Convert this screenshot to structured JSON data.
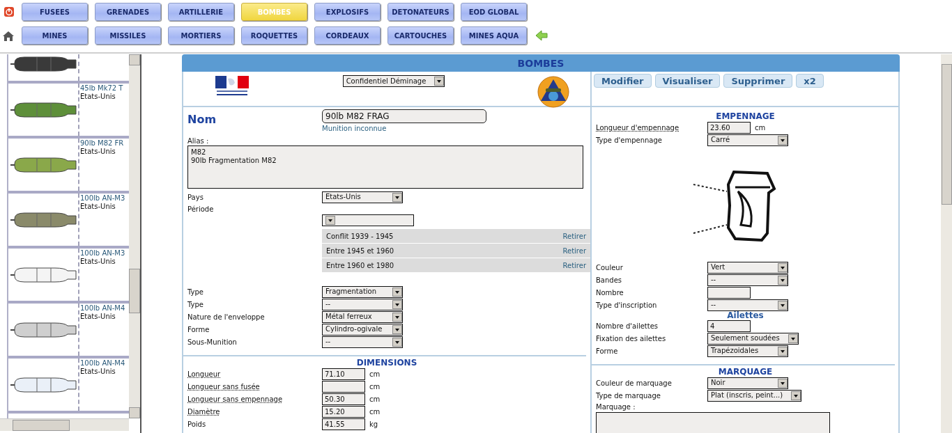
{
  "nav": {
    "rows": [
      [
        {
          "label": "FUSEES",
          "selected": false
        },
        {
          "label": "GRENADES",
          "selected": false
        },
        {
          "label": "ARTILLERIE",
          "selected": false
        },
        {
          "label": "BOMBES",
          "selected": true
        },
        {
          "label": "EXPLOSIFS",
          "selected": false
        },
        {
          "label": "DETONATEURS",
          "selected": false
        },
        {
          "label": "EOD GLOBAL",
          "selected": false
        }
      ],
      [
        {
          "label": "MINES",
          "selected": false
        },
        {
          "label": "MISSILES",
          "selected": false
        },
        {
          "label": "MORTIERS",
          "selected": false
        },
        {
          "label": "ROQUETTES",
          "selected": false
        },
        {
          "label": "CORDEAUX",
          "selected": false
        },
        {
          "label": "CARTOUCHES",
          "selected": false
        },
        {
          "label": "MINES AQUA",
          "selected": false
        }
      ]
    ]
  },
  "sidebar": {
    "items": [
      {
        "color": "#3a3a3a"
      },
      {
        "title": "45lb Mk72 T",
        "country": "Etats-Unis",
        "color": "#5e8f3a"
      },
      {
        "title": "90lb M82 FR",
        "country": "Etats-Unis",
        "color": "#8aa84a"
      },
      {
        "title": "100lb AN-M3",
        "country": "Etats-Unis",
        "color": "#8a8a6a"
      },
      {
        "title": "100lb AN-M3",
        "country": "Etats-Unis",
        "color": "#f4f4f4"
      },
      {
        "title": "100lb AN-M4",
        "country": "Etats-Unis",
        "color": "#cfcfcf"
      },
      {
        "title": "100lb AN-M4",
        "country": "Etats-Unis",
        "color": "#eaf0f8"
      }
    ]
  },
  "panel": {
    "title": "BOMBES",
    "classification": "Confidentiel Déminage",
    "actions": [
      "Modifier",
      "Visualiser",
      "Supprimer",
      "x2"
    ],
    "name": {
      "label": "Nom",
      "value": "90lb M82 FRAG",
      "status": "Munition inconnue"
    },
    "alias": {
      "label": "Alias :",
      "value": "M82\n90lb Fragmentation M82"
    },
    "country": {
      "label": "Pays",
      "value": "Etats-Unis"
    },
    "period": {
      "label": "Période",
      "entries": [
        {
          "label": "Conflit 1939 - 1945",
          "action": "Retirer"
        },
        {
          "label": "Entre 1945 et 1960",
          "action": "Retirer"
        },
        {
          "label": "Entre 1960 et 1980",
          "action": "Retirer"
        }
      ]
    },
    "fields": [
      {
        "kind": "select",
        "label": "Type",
        "value": "Fragmentation",
        "dotted": false
      },
      {
        "kind": "select",
        "label": "Type",
        "value": "--",
        "dotted": false
      },
      {
        "kind": "select",
        "label": "Nature de l'enveloppe",
        "value": "Métal ferreux",
        "dotted": false
      },
      {
        "kind": "select",
        "label": "Forme",
        "value": "Cylindro-ogivale",
        "dotted": false
      },
      {
        "kind": "select",
        "label": "Sous-Munition",
        "value": "--",
        "dotted": false
      }
    ],
    "dimensions": {
      "title": "DIMENSIONS",
      "fields": [
        {
          "kind": "input",
          "label": "Longueur",
          "value": "71.10",
          "unit": "cm",
          "dotted": true
        },
        {
          "kind": "input",
          "label": "Longueur sans fusée",
          "unit": "cm",
          "dotted": true
        },
        {
          "kind": "input",
          "label": "Longueur sans empennage",
          "value": "50.30",
          "unit": "cm",
          "dotted": true
        },
        {
          "kind": "input",
          "label": "Diamètre",
          "value": "15.20",
          "unit": "cm",
          "dotted": true
        },
        {
          "kind": "input",
          "label": "Poids",
          "value": "41.55",
          "unit": "kg",
          "dotted": false
        }
      ]
    },
    "empennage": {
      "title": "EMPENNAGE",
      "fields": [
        {
          "kind": "input",
          "label": "Longueur d'empennage",
          "value": "23.60",
          "unit": "cm",
          "dotted": true
        },
        {
          "kind": "select",
          "label": "Type d'empennage",
          "value": "Carré",
          "dotted": false
        }
      ],
      "fields_after": [
        {
          "kind": "select",
          "label": "Couleur",
          "value": "Vert",
          "dotted": false
        },
        {
          "kind": "select",
          "label": "Bandes",
          "value": "--",
          "dotted": false
        },
        {
          "kind": "input",
          "label": "Nombre",
          "dotted": false
        },
        {
          "kind": "select",
          "label": "Type d'inscription",
          "value": "--",
          "dotted": false
        }
      ]
    },
    "ailettes": {
      "title": "Ailettes",
      "fields": [
        {
          "kind": "input",
          "label": "Nombre d'ailettes",
          "value": "4",
          "dotted": false
        },
        {
          "kind": "select",
          "label": "Fixation des ailettes",
          "value": "Seulement soudées",
          "dotted": false
        },
        {
          "kind": "select",
          "label": "Forme",
          "value": "Trapézoidales",
          "dotted": false
        }
      ]
    },
    "marquage": {
      "title": "MARQUAGE",
      "fields": [
        {
          "kind": "select",
          "label": "Couleur de marquage",
          "value": "Noir",
          "dotted": false
        },
        {
          "kind": "select",
          "label": "Type de marquage",
          "value": "Plat (inscris, peint...)",
          "dotted": false
        }
      ],
      "text_label": "Marquage :"
    }
  }
}
